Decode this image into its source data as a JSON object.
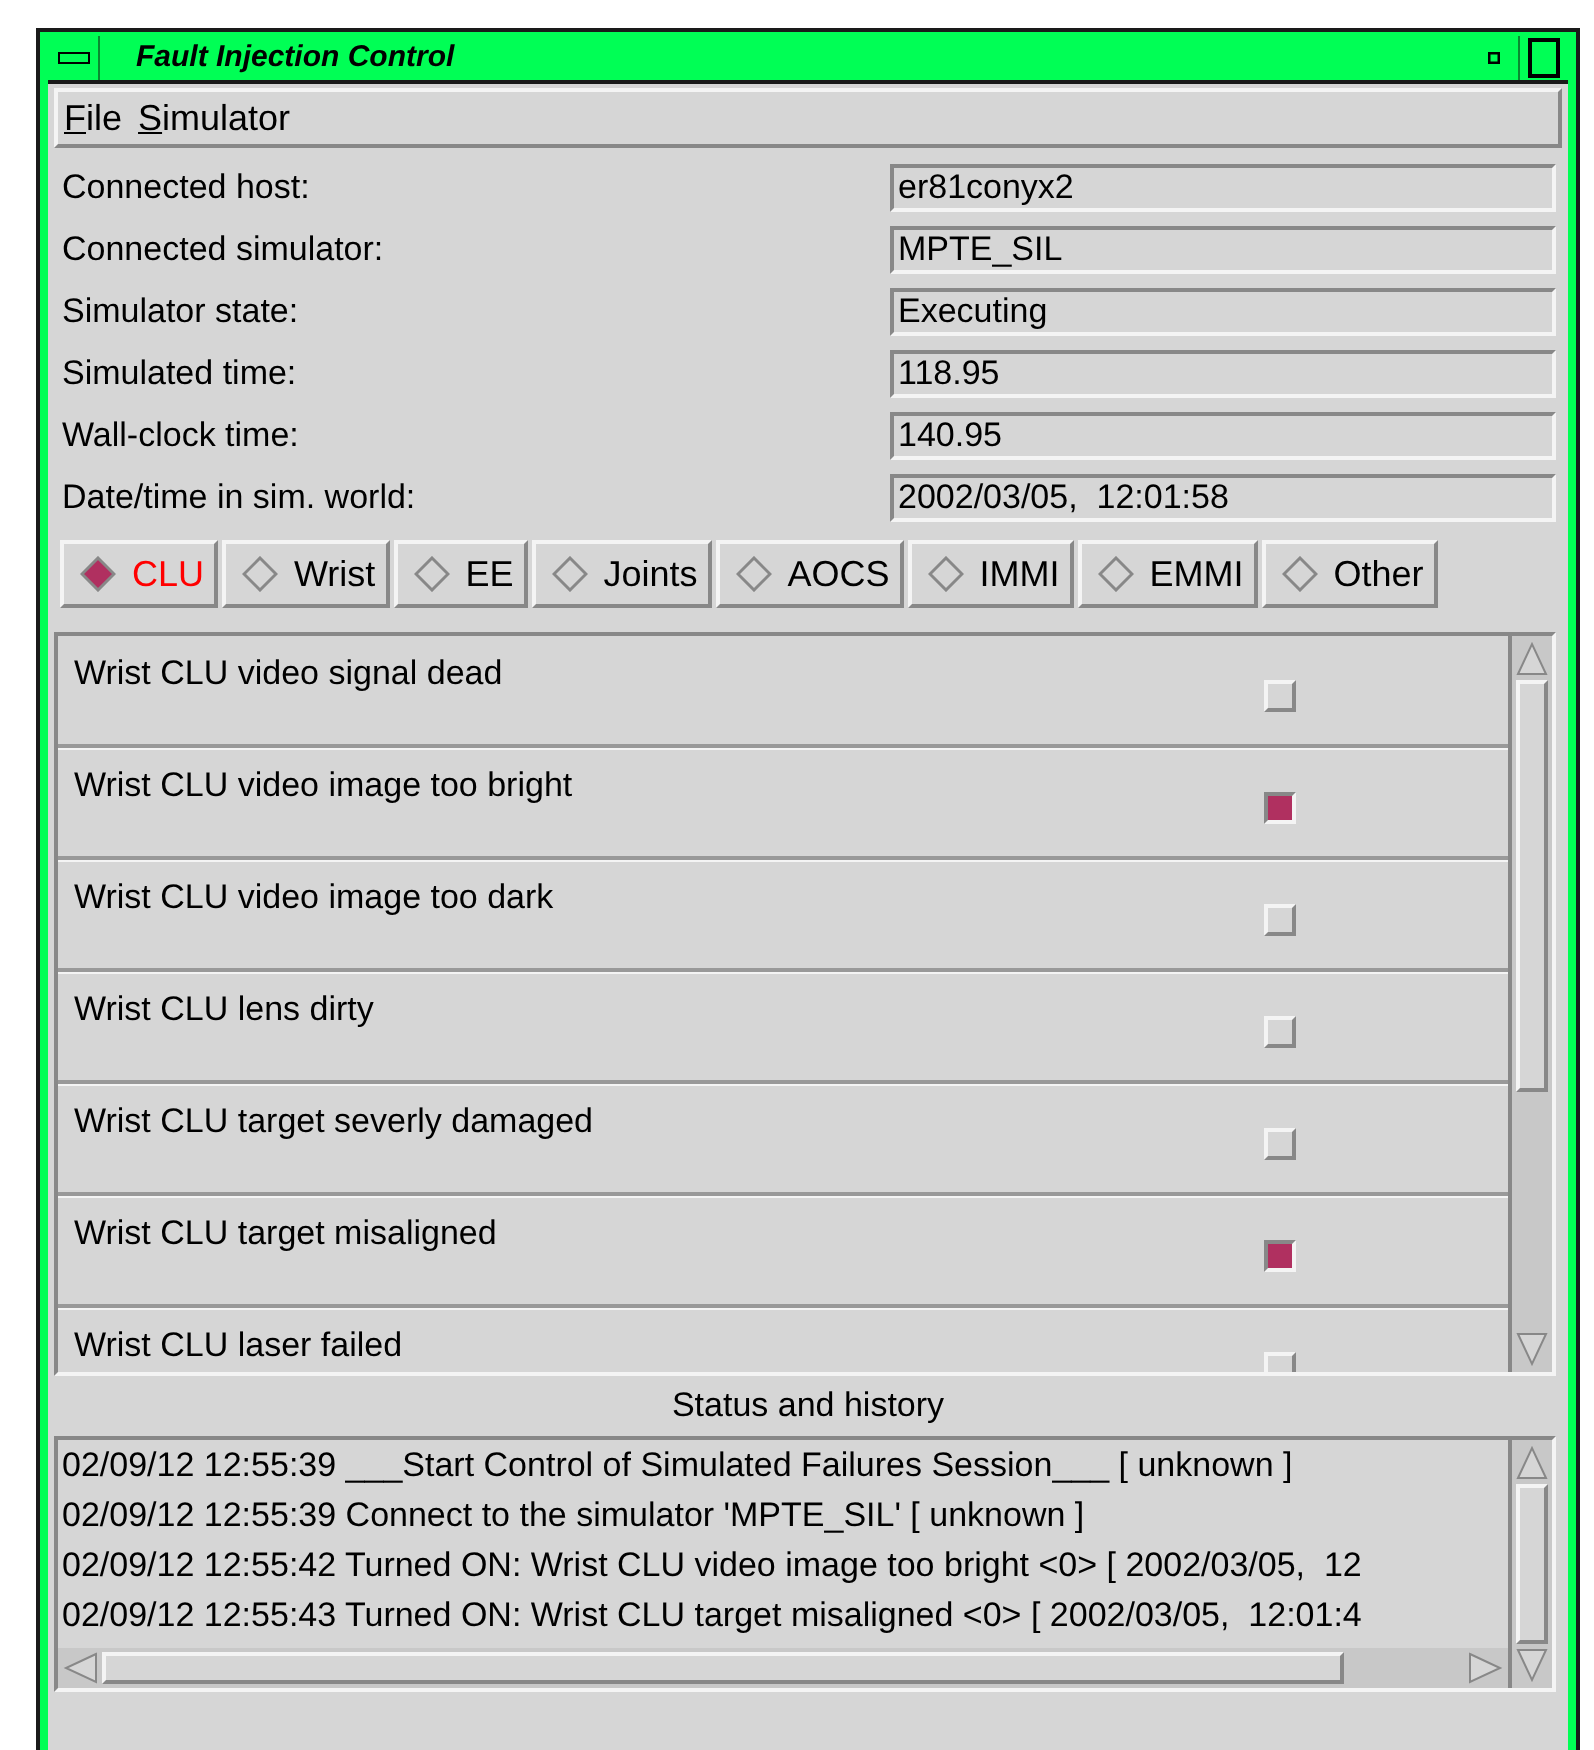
{
  "window": {
    "title": "Fault Injection Control"
  },
  "menu": [
    "File",
    "Simulator"
  ],
  "info": [
    {
      "label": "Connected host:",
      "value": "er81conyx2"
    },
    {
      "label": "Connected simulator:",
      "value": "MPTE_SIL"
    },
    {
      "label": "Simulator state:",
      "value": "Executing"
    },
    {
      "label": "Simulated time:",
      "value": "118.95"
    },
    {
      "label": "Wall-clock time:",
      "value": "140.95"
    },
    {
      "label": "Date/time in sim. world:",
      "value": "2002/03/05,  12:01:58"
    }
  ],
  "tabs": [
    {
      "label": "CLU",
      "selected": true
    },
    {
      "label": "Wrist",
      "selected": false
    },
    {
      "label": "EE",
      "selected": false
    },
    {
      "label": "Joints",
      "selected": false
    },
    {
      "label": "AOCS",
      "selected": false
    },
    {
      "label": "IMMI",
      "selected": false
    },
    {
      "label": "EMMI",
      "selected": false
    },
    {
      "label": "Other",
      "selected": false
    }
  ],
  "faults": [
    {
      "label": "Wrist CLU video signal dead",
      "checked": false
    },
    {
      "label": "Wrist CLU video image too bright",
      "checked": true
    },
    {
      "label": "Wrist CLU video image too dark",
      "checked": false
    },
    {
      "label": "Wrist CLU lens dirty",
      "checked": false
    },
    {
      "label": "Wrist CLU target severly damaged",
      "checked": false
    },
    {
      "label": "Wrist CLU target misaligned",
      "checked": true
    },
    {
      "label": "Wrist CLU laser failed",
      "checked": false
    }
  ],
  "status": {
    "title": "Status and history",
    "log": [
      "02/09/12 12:55:39 ___Start Control of Simulated Failures Session___ [ unknown ]",
      "02/09/12 12:55:39 Connect to the simulator 'MPTE_SIL' [ unknown ]",
      "02/09/12 12:55:42 Turned ON: Wrist CLU video image too bright <0> [ 2002/03/05,  12",
      "02/09/12 12:55:43 Turned ON: Wrist CLU target misaligned <0> [ 2002/03/05,  12:01:4"
    ]
  }
}
